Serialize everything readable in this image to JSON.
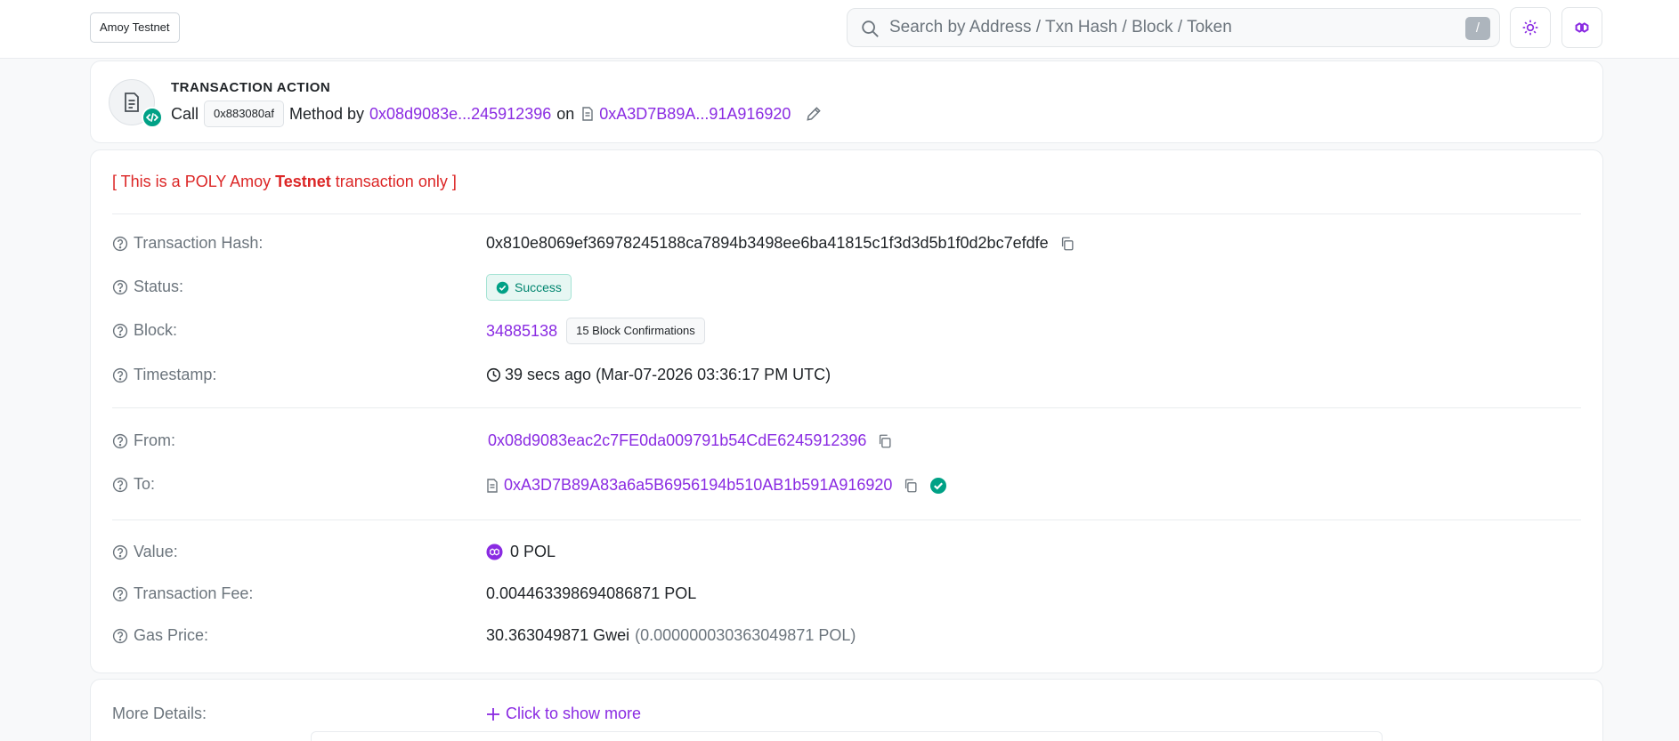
{
  "header": {
    "network_button": "Amoy Testnet",
    "search_placeholder": "Search by Address / Txn Hash / Block / Token",
    "search_shortcut": "/"
  },
  "action": {
    "title": "TRANSACTION ACTION",
    "call": "Call",
    "method_id": "0x883080af",
    "method_by": "Method by",
    "from_short": "0x08d9083e...245912396",
    "on": "on",
    "to_short": "0xA3D7B89A...91A916920"
  },
  "notice": {
    "prefix": "[ This is a POLY Amoy ",
    "bold": "Testnet",
    "suffix": " transaction only ]"
  },
  "details": {
    "hash_label": "Transaction Hash:",
    "hash_value": "0x810e8069ef36978245188ca7894b3498ee6ba41815c1f3d3d5b1f0d2bc7efdfe",
    "status_label": "Status:",
    "status_value": "Success",
    "block_label": "Block:",
    "block_value": "34885138",
    "block_confirmations": "15 Block Confirmations",
    "timestamp_label": "Timestamp:",
    "timestamp_value": "39 secs ago (Mar-07-2026 03:36:17 PM UTC)",
    "from_label": "From:",
    "from_value": "0x08d9083eac2c7FE0da009791b54CdE6245912396",
    "to_label": "To:",
    "to_value": "0xA3D7B89A83a6a5B6956194b510AB1b591A916920",
    "value_label": "Value:",
    "value_value": "0 POL",
    "fee_label": "Transaction Fee:",
    "fee_value": "0.004463398694086871 POL",
    "gas_label": "Gas Price:",
    "gas_value": "30.363049871 Gwei",
    "gas_pol": "(0.000000030363049871 POL)"
  },
  "more": {
    "label": "More Details:",
    "link": "Click to show more"
  },
  "colors": {
    "accent": "#8a2be2",
    "success": "#00a186",
    "danger": "#dc2626"
  }
}
